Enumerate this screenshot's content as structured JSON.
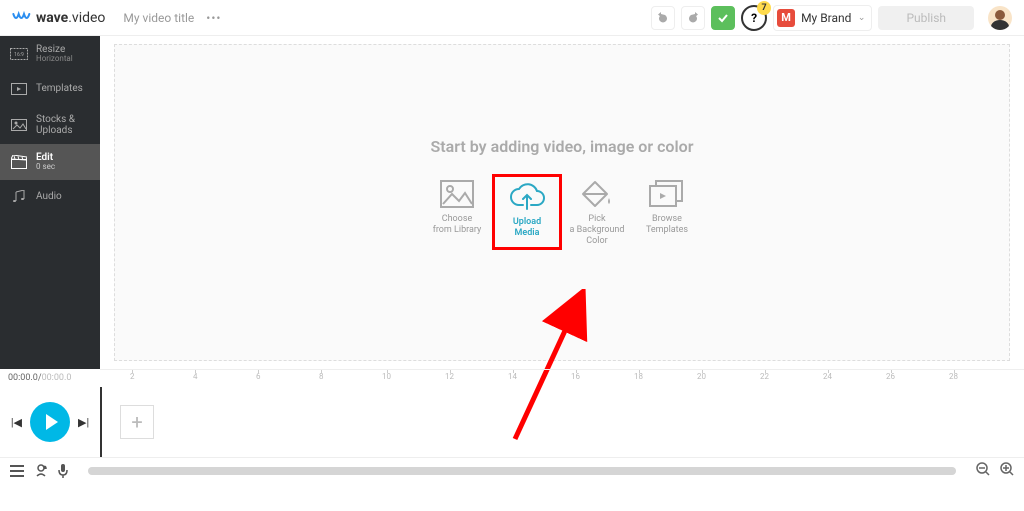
{
  "header": {
    "logo_text_bold": "wave",
    "logo_text_light": ".video",
    "project_title": "My video title",
    "help_badge": "7",
    "brand_letter": "M",
    "brand_name": "My Brand",
    "publish": "Publish"
  },
  "sidebar": {
    "items": [
      {
        "title": "Resize",
        "sub": "Horizontal",
        "iconRatio": "16:9"
      },
      {
        "title": "Templates",
        "sub": ""
      },
      {
        "title": "Stocks & Uploads",
        "sub": ""
      },
      {
        "title": "Edit",
        "sub": "0 sec"
      },
      {
        "title": "Audio",
        "sub": ""
      }
    ]
  },
  "canvas": {
    "heading": "Start by adding video, image or color",
    "actions": [
      {
        "line1": "Choose",
        "line2": "from Library"
      },
      {
        "line1": "Upload",
        "line2": "Media"
      },
      {
        "line1": "Pick",
        "line2": "a Background",
        "line3": "Color"
      },
      {
        "line1": "Browse",
        "line2": "Templates"
      }
    ]
  },
  "timeline": {
    "current": "00:00.0",
    "total": "00:00.0",
    "ticks": [
      "2",
      "4",
      "6",
      "8",
      "10",
      "12",
      "14",
      "16",
      "18",
      "20",
      "22",
      "24",
      "26",
      "28"
    ]
  }
}
